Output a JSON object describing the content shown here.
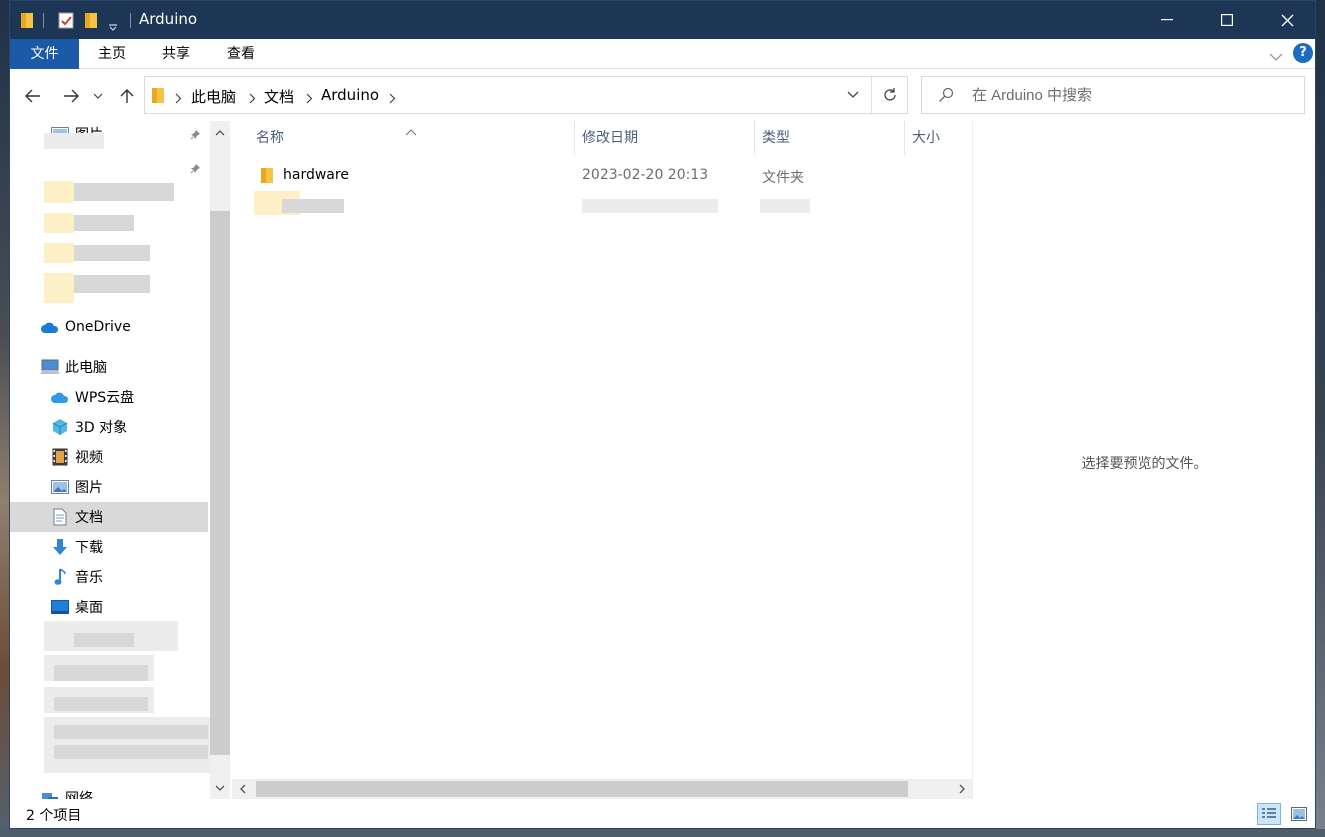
{
  "window": {
    "title": "Arduino",
    "qat_icons": [
      "folder-icon",
      "properties-icon",
      "new-folder-icon",
      "customize-dropdown-icon"
    ],
    "controls": [
      "minimize-icon",
      "maximize-icon",
      "close-icon"
    ]
  },
  "ribbon": {
    "tabs": [
      {
        "label": "文件"
      },
      {
        "label": "主页"
      },
      {
        "label": "共享"
      },
      {
        "label": "查看"
      }
    ],
    "help_label": "?"
  },
  "address": {
    "crumbs": [
      "此电脑",
      "文档",
      "Arduino"
    ]
  },
  "search": {
    "placeholder": "在 Arduino 中搜索"
  },
  "nav": {
    "quick_access_visible": [
      {
        "label": "图片",
        "icon": "pictures-icon"
      }
    ],
    "onedrive": {
      "label": "OneDrive",
      "icon": "cloud-icon"
    },
    "thispc": {
      "label": "此电脑",
      "icon": "computer-icon"
    },
    "items": [
      {
        "label": "WPS云盘",
        "icon": "wps-cloud-icon"
      },
      {
        "label": "3D 对象",
        "icon": "cube-icon"
      },
      {
        "label": "视频",
        "icon": "film-icon"
      },
      {
        "label": "图片",
        "icon": "pictures-icon"
      },
      {
        "label": "文档",
        "icon": "document-icon",
        "selected": true
      },
      {
        "label": "下载",
        "icon": "download-icon"
      },
      {
        "label": "音乐",
        "icon": "music-icon"
      },
      {
        "label": "桌面",
        "icon": "desktop-icon"
      }
    ],
    "network": {
      "label": "网络",
      "icon": "network-icon"
    }
  },
  "columns": [
    "名称",
    "修改日期",
    "类型",
    "大小"
  ],
  "files": [
    {
      "name": "hardware",
      "modified": "2023-02-20 20:13",
      "type": "文件夹"
    }
  ],
  "preview_message": "选择要预览的文件。",
  "status": {
    "item_count": "2 个项目"
  },
  "colors": {
    "titlebar": "#1e3656",
    "file_tab": "#1c5aa7",
    "selected_nav": "#d9d9d9",
    "header_text": "#4c607a"
  }
}
